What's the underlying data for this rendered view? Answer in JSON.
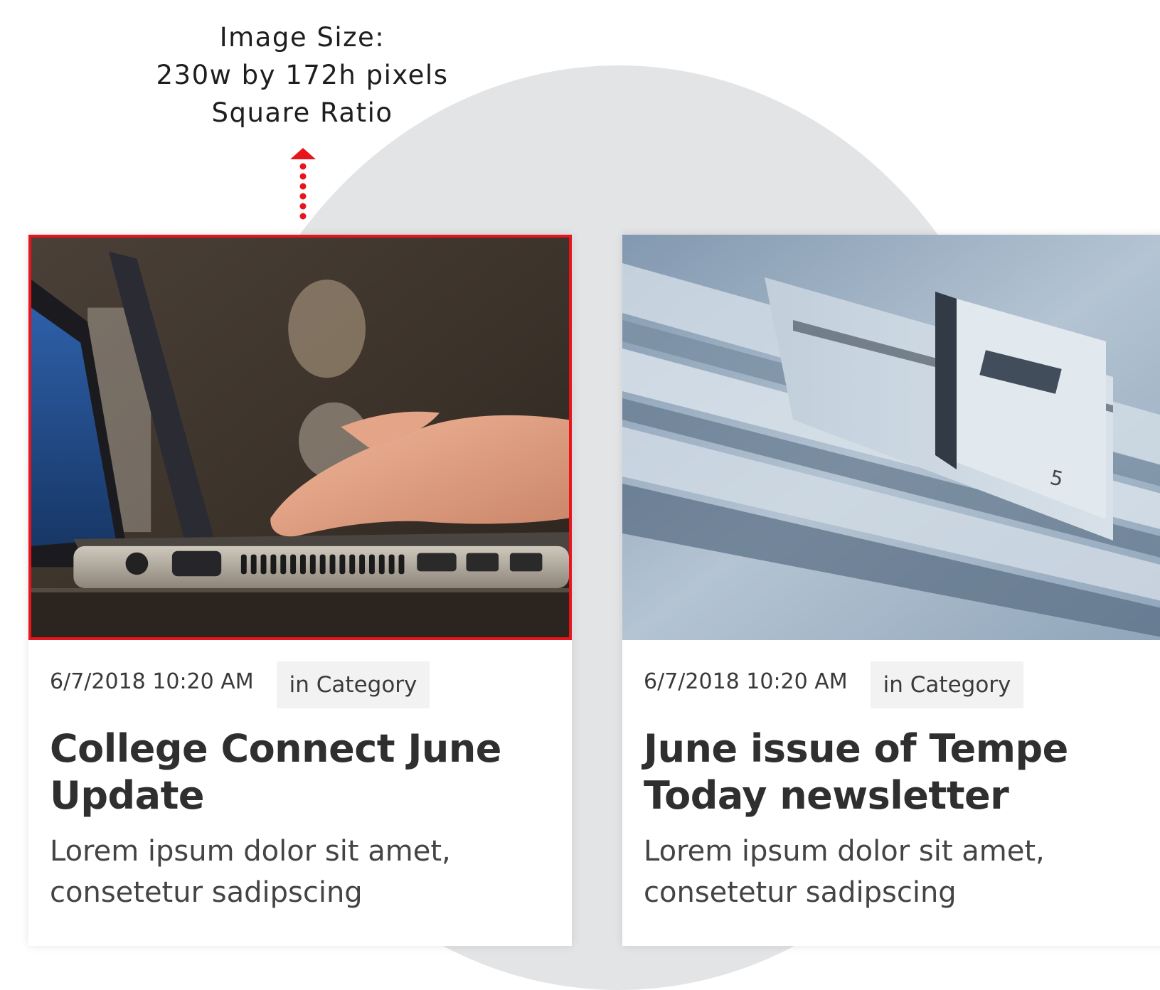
{
  "annotation": {
    "line1": "Image Size:",
    "line2": "230w by 172h pixels",
    "line3": "Square Ratio"
  },
  "colors": {
    "highlight": "#e8141c",
    "background_arc": "#e3e4e6",
    "title_text": "#2f2f2f"
  },
  "cards": [
    {
      "image_alt": "laptop-typing-photo",
      "date": "6/7/2018 10:20 AM",
      "category": "in Category",
      "title": "College Connect June Update",
      "excerpt": "Lorem ipsum dolor sit amet, consetetur sadipscing"
    },
    {
      "image_alt": "newspaper-stack-photo",
      "date": "6/7/2018 10:20 AM",
      "category": "in Category",
      "title": "June issue of Tempe Today newsletter",
      "excerpt": "Lorem ipsum dolor sit amet, consetetur sadipscing"
    }
  ]
}
